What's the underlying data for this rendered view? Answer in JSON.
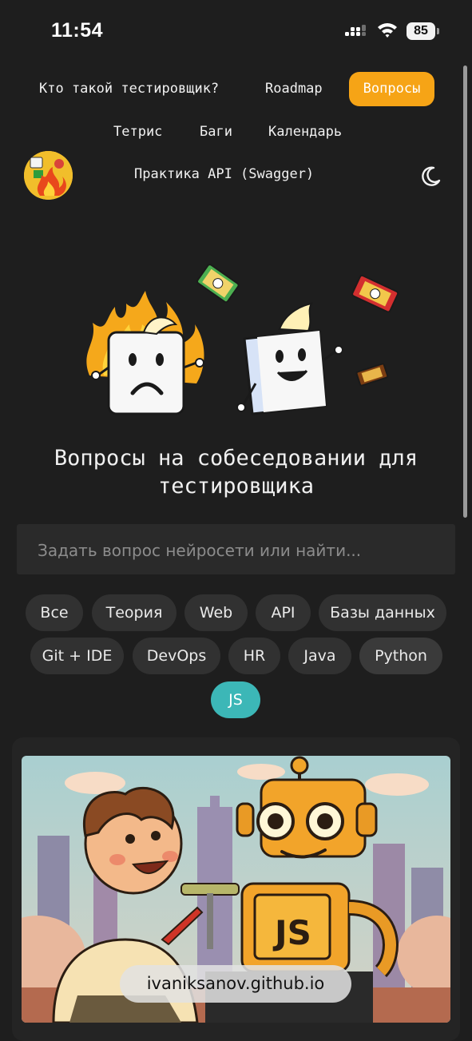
{
  "status_bar": {
    "time": "11:54",
    "battery": "85"
  },
  "nav": {
    "links": [
      "Кто такой тестировщик?",
      "Roadmap",
      "Вопросы",
      "Тетрис",
      "Баги",
      "Календарь",
      "Практика API (Swagger)"
    ],
    "active": "Вопросы"
  },
  "hero": {
    "title_line1": "Вопросы на собеседовании для",
    "title_line2": "тестировщика"
  },
  "search": {
    "placeholder": "Задать вопрос нейросети или найти..."
  },
  "categories": [
    "Все",
    "Теория",
    "Web",
    "API",
    "Базы данных",
    "Git + IDE",
    "DevOps",
    "HR",
    "Java",
    "Python",
    "JS"
  ],
  "selected_category": "JS",
  "card": {
    "robot_badge": "JS"
  },
  "browser": {
    "url": "ivaniksanov.github.io"
  },
  "colors": {
    "accent_orange": "#f6a416",
    "chip_selected": "#3cb7b7",
    "background": "#1e1e1e"
  }
}
